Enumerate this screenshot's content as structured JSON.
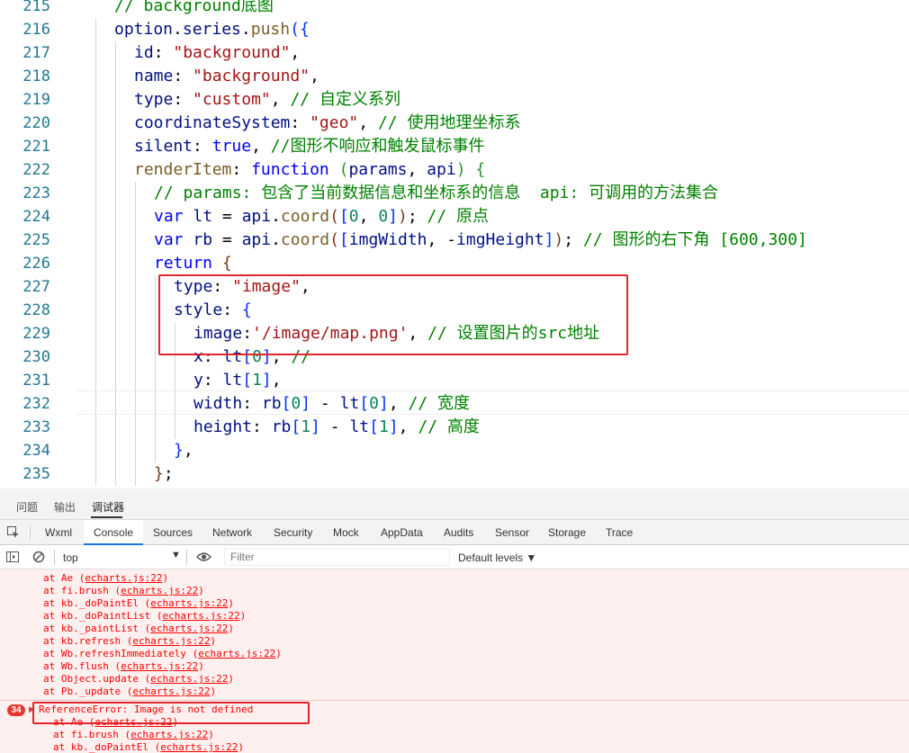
{
  "editor": {
    "lines": [
      {
        "num": "215",
        "indent": 1,
        "tokens": [
          {
            "c": "t-com",
            "t": "// background底图"
          }
        ]
      },
      {
        "num": "216",
        "indent": 1,
        "tokens": [
          {
            "c": "t-prop",
            "t": "option"
          },
          {
            "c": "",
            "t": "."
          },
          {
            "c": "t-prop",
            "t": "series"
          },
          {
            "c": "",
            "t": "."
          },
          {
            "c": "t-fn",
            "t": "push"
          },
          {
            "c": "t-brk",
            "t": "({"
          }
        ]
      },
      {
        "num": "217",
        "indent": 2,
        "tokens": [
          {
            "c": "t-prop",
            "t": "id"
          },
          {
            "c": "",
            "t": ": "
          },
          {
            "c": "t-str",
            "t": "\"background\""
          },
          {
            "c": "",
            "t": ","
          }
        ]
      },
      {
        "num": "218",
        "indent": 2,
        "tokens": [
          {
            "c": "t-prop",
            "t": "name"
          },
          {
            "c": "",
            "t": ": "
          },
          {
            "c": "t-str",
            "t": "\"background\""
          },
          {
            "c": "",
            "t": ","
          }
        ]
      },
      {
        "num": "219",
        "indent": 2,
        "tokens": [
          {
            "c": "t-prop",
            "t": "type"
          },
          {
            "c": "",
            "t": ": "
          },
          {
            "c": "t-str",
            "t": "\"custom\""
          },
          {
            "c": "",
            "t": ", "
          },
          {
            "c": "t-com",
            "t": "// 自定义系列"
          }
        ]
      },
      {
        "num": "220",
        "indent": 2,
        "tokens": [
          {
            "c": "t-prop",
            "t": "coordinateSystem"
          },
          {
            "c": "",
            "t": ": "
          },
          {
            "c": "t-str",
            "t": "\"geo\""
          },
          {
            "c": "",
            "t": ", "
          },
          {
            "c": "t-com",
            "t": "// 使用地理坐标系"
          }
        ]
      },
      {
        "num": "221",
        "indent": 2,
        "tokens": [
          {
            "c": "t-prop",
            "t": "silent"
          },
          {
            "c": "",
            "t": ": "
          },
          {
            "c": "t-key",
            "t": "true"
          },
          {
            "c": "",
            "t": ", "
          },
          {
            "c": "t-com",
            "t": "//图形不响应和触发鼠标事件"
          }
        ]
      },
      {
        "num": "222",
        "indent": 2,
        "tokens": [
          {
            "c": "t-fn",
            "t": "renderItem"
          },
          {
            "c": "",
            "t": ": "
          },
          {
            "c": "t-key",
            "t": "function"
          },
          {
            "c": "",
            "t": " "
          },
          {
            "c": "t-brk2",
            "t": "("
          },
          {
            "c": "t-par",
            "t": "params"
          },
          {
            "c": "",
            "t": ", "
          },
          {
            "c": "t-par",
            "t": "api"
          },
          {
            "c": "t-brk2",
            "t": ")"
          },
          {
            "c": "",
            "t": " "
          },
          {
            "c": "t-brk2",
            "t": "{"
          }
        ]
      },
      {
        "num": "223",
        "indent": 3,
        "tokens": [
          {
            "c": "t-com",
            "t": "// params: 包含了当前数据信息和坐标系的信息  api: 可调用的方法集合"
          }
        ]
      },
      {
        "num": "224",
        "indent": 3,
        "tokens": [
          {
            "c": "t-key",
            "t": "var"
          },
          {
            "c": "",
            "t": " "
          },
          {
            "c": "t-prop",
            "t": "lt"
          },
          {
            "c": "",
            "t": " = "
          },
          {
            "c": "t-prop",
            "t": "api"
          },
          {
            "c": "",
            "t": "."
          },
          {
            "c": "t-fn",
            "t": "coord"
          },
          {
            "c": "t-brk3",
            "t": "("
          },
          {
            "c": "t-brk",
            "t": "["
          },
          {
            "c": "t-num",
            "t": "0"
          },
          {
            "c": "",
            "t": ", "
          },
          {
            "c": "t-num",
            "t": "0"
          },
          {
            "c": "t-brk",
            "t": "]"
          },
          {
            "c": "t-brk3",
            "t": ")"
          },
          {
            "c": "",
            "t": "; "
          },
          {
            "c": "t-com",
            "t": "// 原点"
          }
        ]
      },
      {
        "num": "225",
        "indent": 3,
        "tokens": [
          {
            "c": "t-key",
            "t": "var"
          },
          {
            "c": "",
            "t": " "
          },
          {
            "c": "t-prop",
            "t": "rb"
          },
          {
            "c": "",
            "t": " = "
          },
          {
            "c": "t-prop",
            "t": "api"
          },
          {
            "c": "",
            "t": "."
          },
          {
            "c": "t-fn",
            "t": "coord"
          },
          {
            "c": "t-brk3",
            "t": "("
          },
          {
            "c": "t-brk",
            "t": "["
          },
          {
            "c": "t-prop",
            "t": "imgWidth"
          },
          {
            "c": "",
            "t": ", -"
          },
          {
            "c": "t-prop",
            "t": "imgHeight"
          },
          {
            "c": "t-brk",
            "t": "]"
          },
          {
            "c": "t-brk3",
            "t": ")"
          },
          {
            "c": "",
            "t": "; "
          },
          {
            "c": "t-com",
            "t": "// 图形的右下角 [600,300]"
          }
        ]
      },
      {
        "num": "226",
        "indent": 3,
        "tokens": [
          {
            "c": "t-key",
            "t": "return"
          },
          {
            "c": "",
            "t": " "
          },
          {
            "c": "t-brk3",
            "t": "{"
          }
        ]
      },
      {
        "num": "227",
        "indent": 4,
        "tokens": [
          {
            "c": "t-prop",
            "t": "type"
          },
          {
            "c": "",
            "t": ": "
          },
          {
            "c": "t-str",
            "t": "\"image\""
          },
          {
            "c": "",
            "t": ","
          }
        ]
      },
      {
        "num": "228",
        "indent": 4,
        "tokens": [
          {
            "c": "t-prop",
            "t": "style"
          },
          {
            "c": "",
            "t": ": "
          },
          {
            "c": "t-brk",
            "t": "{"
          }
        ]
      },
      {
        "num": "229",
        "indent": 5,
        "tokens": [
          {
            "c": "t-prop",
            "t": "image"
          },
          {
            "c": "",
            "t": ":"
          },
          {
            "c": "t-str",
            "t": "'/image/map.png'"
          },
          {
            "c": "",
            "t": ", "
          },
          {
            "c": "t-com",
            "t": "// 设置图片的src地址"
          }
        ]
      },
      {
        "num": "230",
        "indent": 5,
        "tokens": [
          {
            "c": "t-prop",
            "t": "x"
          },
          {
            "c": "",
            "t": ": "
          },
          {
            "c": "t-prop",
            "t": "lt"
          },
          {
            "c": "t-brk",
            "t": "["
          },
          {
            "c": "t-num",
            "t": "0"
          },
          {
            "c": "t-brk",
            "t": "]"
          },
          {
            "c": "",
            "t": ", "
          },
          {
            "c": "t-com",
            "t": "//"
          }
        ]
      },
      {
        "num": "231",
        "indent": 5,
        "tokens": [
          {
            "c": "t-prop",
            "t": "y"
          },
          {
            "c": "",
            "t": ": "
          },
          {
            "c": "t-prop",
            "t": "lt"
          },
          {
            "c": "t-brk",
            "t": "["
          },
          {
            "c": "t-num",
            "t": "1"
          },
          {
            "c": "t-brk",
            "t": "]"
          },
          {
            "c": "",
            "t": ","
          }
        ]
      },
      {
        "num": "232",
        "indent": 5,
        "tokens": [
          {
            "c": "t-prop",
            "t": "width"
          },
          {
            "c": "",
            "t": ": "
          },
          {
            "c": "t-prop",
            "t": "rb"
          },
          {
            "c": "t-brk",
            "t": "["
          },
          {
            "c": "t-num",
            "t": "0"
          },
          {
            "c": "t-brk",
            "t": "]"
          },
          {
            "c": "",
            "t": " - "
          },
          {
            "c": "t-prop",
            "t": "lt"
          },
          {
            "c": "t-brk",
            "t": "["
          },
          {
            "c": "t-num",
            "t": "0"
          },
          {
            "c": "t-brk",
            "t": "]"
          },
          {
            "c": "",
            "t": ", "
          },
          {
            "c": "t-com",
            "t": "// 宽度"
          }
        ]
      },
      {
        "num": "233",
        "indent": 5,
        "tokens": [
          {
            "c": "t-prop",
            "t": "height"
          },
          {
            "c": "",
            "t": ": "
          },
          {
            "c": "t-prop",
            "t": "rb"
          },
          {
            "c": "t-brk",
            "t": "["
          },
          {
            "c": "t-num",
            "t": "1"
          },
          {
            "c": "t-brk",
            "t": "]"
          },
          {
            "c": "",
            "t": " - "
          },
          {
            "c": "t-prop",
            "t": "lt"
          },
          {
            "c": "t-brk",
            "t": "["
          },
          {
            "c": "t-num",
            "t": "1"
          },
          {
            "c": "t-brk",
            "t": "]"
          },
          {
            "c": "",
            "t": ", "
          },
          {
            "c": "t-com",
            "t": "// 高度"
          }
        ]
      },
      {
        "num": "234",
        "indent": 4,
        "tokens": [
          {
            "c": "t-brk",
            "t": "}"
          },
          {
            "c": "",
            "t": ","
          }
        ]
      },
      {
        "num": "235",
        "indent": 3,
        "tokens": [
          {
            "c": "t-brk3",
            "t": "}"
          },
          {
            "c": "",
            "t": ";"
          }
        ]
      }
    ]
  },
  "devtools": {
    "panel_tabs": [
      {
        "label": "问题",
        "active": false
      },
      {
        "label": "输出",
        "active": false
      },
      {
        "label": "调试器",
        "active": true
      }
    ],
    "tool_tabs": [
      {
        "label": "Wxml",
        "active": false
      },
      {
        "label": "Console",
        "active": true
      },
      {
        "label": "Sources",
        "active": false
      },
      {
        "label": "Network",
        "active": false
      },
      {
        "label": "Security",
        "active": false
      },
      {
        "label": "Mock",
        "active": false
      },
      {
        "label": "AppData",
        "active": false
      },
      {
        "label": "Audits",
        "active": false
      },
      {
        "label": "Sensor",
        "active": false
      },
      {
        "label": "Storage",
        "active": false
      },
      {
        "label": "Trace",
        "active": false
      }
    ],
    "toolbar": {
      "context": "top",
      "context_arrow": "▼",
      "filter_placeholder": "Filter",
      "levels": "Default levels ▼"
    },
    "stack_top": [
      {
        "fn": "at Ae ",
        "src": "echarts.js:22"
      },
      {
        "fn": "at fi.brush ",
        "src": "echarts.js:22"
      },
      {
        "fn": "at kb._doPaintEl ",
        "src": "echarts.js:22"
      },
      {
        "fn": "at kb._doPaintList ",
        "src": "echarts.js:22"
      },
      {
        "fn": "at kb._paintList ",
        "src": "echarts.js:22"
      },
      {
        "fn": "at kb.refresh ",
        "src": "echarts.js:22"
      },
      {
        "fn": "at Wb.refreshImmediately ",
        "src": "echarts.js:22"
      },
      {
        "fn": "at Wb.flush ",
        "src": "echarts.js:22"
      },
      {
        "fn": "at Object.update ",
        "src": "echarts.js:22"
      },
      {
        "fn": "at Pb._update ",
        "src": "echarts.js:22"
      }
    ],
    "error": {
      "count": "34",
      "caret": "▶",
      "message": "ReferenceError: Image is not defined"
    },
    "stack_bottom": [
      {
        "fn": "at Ae ",
        "src": "echarts.js:22"
      },
      {
        "fn": "at fi.brush ",
        "src": "echarts.js:22"
      },
      {
        "fn": "at kb._doPaintEl ",
        "src": "echarts.js:22"
      }
    ]
  }
}
